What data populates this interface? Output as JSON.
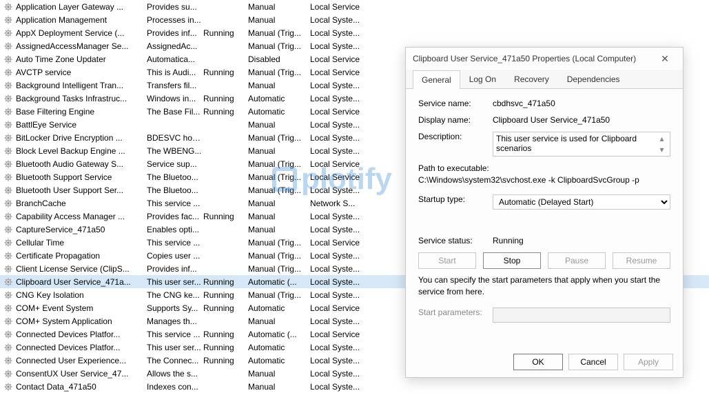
{
  "services": [
    {
      "name": "Application Layer Gateway ...",
      "desc": "Provides su...",
      "status": "",
      "startup": "Manual",
      "logon": "Local Service"
    },
    {
      "name": "Application Management",
      "desc": "Processes in...",
      "status": "",
      "startup": "Manual",
      "logon": "Local Syste..."
    },
    {
      "name": "AppX Deployment Service (...",
      "desc": "Provides inf...",
      "status": "Running",
      "startup": "Manual (Trig...",
      "logon": "Local Syste..."
    },
    {
      "name": "AssignedAccessManager Se...",
      "desc": "AssignedAc...",
      "status": "",
      "startup": "Manual (Trig...",
      "logon": "Local Syste..."
    },
    {
      "name": "Auto Time Zone Updater",
      "desc": "Automatica...",
      "status": "",
      "startup": "Disabled",
      "logon": "Local Service"
    },
    {
      "name": "AVCTP service",
      "desc": "This is Audi...",
      "status": "Running",
      "startup": "Manual (Trig...",
      "logon": "Local Service"
    },
    {
      "name": "Background Intelligent Tran...",
      "desc": "Transfers fil...",
      "status": "",
      "startup": "Manual",
      "logon": "Local Syste..."
    },
    {
      "name": "Background Tasks Infrastruc...",
      "desc": "Windows in...",
      "status": "Running",
      "startup": "Automatic",
      "logon": "Local Syste..."
    },
    {
      "name": "Base Filtering Engine",
      "desc": "The Base Fil...",
      "status": "Running",
      "startup": "Automatic",
      "logon": "Local Service"
    },
    {
      "name": "BattlEye Service",
      "desc": "",
      "status": "",
      "startup": "Manual",
      "logon": "Local Syste..."
    },
    {
      "name": "BitLocker Drive Encryption ...",
      "desc": "BDESVC hos...",
      "status": "",
      "startup": "Manual (Trig...",
      "logon": "Local Syste..."
    },
    {
      "name": "Block Level Backup Engine ...",
      "desc": "The WBENG...",
      "status": "",
      "startup": "Manual",
      "logon": "Local Syste..."
    },
    {
      "name": "Bluetooth Audio Gateway S...",
      "desc": "Service sup...",
      "status": "",
      "startup": "Manual (Trig...",
      "logon": "Local Service"
    },
    {
      "name": "Bluetooth Support Service",
      "desc": "The Bluetoo...",
      "status": "",
      "startup": "Manual (Trig...",
      "logon": "Local Service"
    },
    {
      "name": "Bluetooth User Support Ser...",
      "desc": "The Bluetoo...",
      "status": "",
      "startup": "Manual (Trig...",
      "logon": "Local Syste..."
    },
    {
      "name": "BranchCache",
      "desc": "This service ...",
      "status": "",
      "startup": "Manual",
      "logon": "Network S..."
    },
    {
      "name": "Capability Access Manager ...",
      "desc": "Provides fac...",
      "status": "Running",
      "startup": "Manual",
      "logon": "Local Syste..."
    },
    {
      "name": "CaptureService_471a50",
      "desc": "Enables opti...",
      "status": "",
      "startup": "Manual",
      "logon": "Local Syste..."
    },
    {
      "name": "Cellular Time",
      "desc": "This service ...",
      "status": "",
      "startup": "Manual (Trig...",
      "logon": "Local Service"
    },
    {
      "name": "Certificate Propagation",
      "desc": "Copies user ...",
      "status": "",
      "startup": "Manual (Trig...",
      "logon": "Local Syste..."
    },
    {
      "name": "Client License Service (ClipS...",
      "desc": "Provides inf...",
      "status": "",
      "startup": "Manual (Trig...",
      "logon": "Local Syste..."
    },
    {
      "name": "Clipboard User Service_471a...",
      "desc": "This user ser...",
      "status": "Running",
      "startup": "Automatic (...",
      "logon": "Local Syste...",
      "selected": true
    },
    {
      "name": "CNG Key Isolation",
      "desc": "The CNG ke...",
      "status": "Running",
      "startup": "Manual (Trig...",
      "logon": "Local Syste..."
    },
    {
      "name": "COM+ Event System",
      "desc": "Supports Sy...",
      "status": "Running",
      "startup": "Automatic",
      "logon": "Local Service"
    },
    {
      "name": "COM+ System Application",
      "desc": "Manages th...",
      "status": "",
      "startup": "Manual",
      "logon": "Local Syste..."
    },
    {
      "name": "Connected Devices Platfor...",
      "desc": "This service ...",
      "status": "Running",
      "startup": "Automatic (...",
      "logon": "Local Service"
    },
    {
      "name": "Connected Devices Platfor...",
      "desc": "This user ser...",
      "status": "Running",
      "startup": "Automatic",
      "logon": "Local Syste..."
    },
    {
      "name": "Connected User Experience...",
      "desc": "The Connec...",
      "status": "Running",
      "startup": "Automatic",
      "logon": "Local Syste..."
    },
    {
      "name": "ConsentUX User Service_47...",
      "desc": "Allows the s...",
      "status": "",
      "startup": "Manual",
      "logon": "Local Syste..."
    },
    {
      "name": "Contact Data_471a50",
      "desc": "Indexes con...",
      "status": "",
      "startup": "Manual",
      "logon": "Local Syste..."
    }
  ],
  "dialog": {
    "title": "Clipboard User Service_471a50 Properties (Local Computer)",
    "tabs": {
      "general": "General",
      "logon": "Log On",
      "recovery": "Recovery",
      "dependencies": "Dependencies"
    },
    "labels": {
      "service_name": "Service name:",
      "display_name": "Display name:",
      "description": "Description:",
      "path": "Path to executable:",
      "startup_type": "Startup type:",
      "service_status": "Service status:",
      "start_params": "Start parameters:"
    },
    "values": {
      "service_name": "cbdhsvc_471a50",
      "display_name": "Clipboard User Service_471a50",
      "description": "This user service is used for Clipboard scenarios",
      "path": "C:\\Windows\\system32\\svchost.exe -k ClipboardSvcGroup -p",
      "startup_type": "Automatic (Delayed Start)",
      "service_status": "Running"
    },
    "buttons": {
      "start": "Start",
      "stop": "Stop",
      "pause": "Pause",
      "resume": "Resume"
    },
    "note": "You can specify the start parameters that apply when you start the service from here.",
    "footer": {
      "ok": "OK",
      "cancel": "Cancel",
      "apply": "Apply"
    }
  },
  "watermark": "plotify"
}
